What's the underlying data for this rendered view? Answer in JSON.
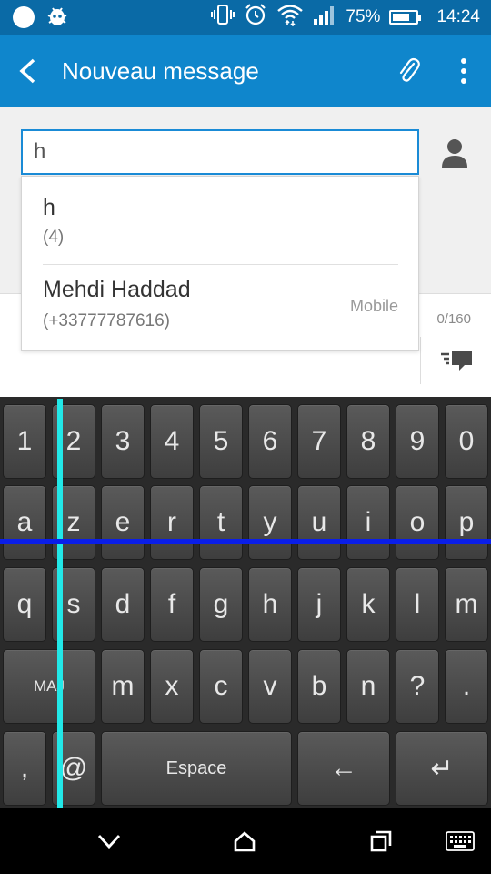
{
  "status_bar": {
    "battery_percent": "75%",
    "time": "14:24",
    "battery_level": 0.75,
    "icons": [
      "circle-notification-icon",
      "bug-icon",
      "vibrate-icon",
      "alarm-icon",
      "wifi-icon",
      "signal-icon",
      "battery-icon"
    ]
  },
  "app_bar": {
    "title": "Nouveau message",
    "icons": [
      "back-arrow-icon",
      "paperclip-icon",
      "overflow-menu-icon"
    ]
  },
  "recipient": {
    "value": "h",
    "placeholder": ""
  },
  "suggestions": [
    {
      "name": "h",
      "number": "(4)",
      "type": ""
    },
    {
      "name": "Mehdi Haddad",
      "number": "(+33777787616)",
      "type": "Mobile"
    }
  ],
  "compose": {
    "char_count": "0/160"
  },
  "keyboard": {
    "rows": [
      [
        "1",
        "2",
        "3",
        "4",
        "5",
        "6",
        "7",
        "8",
        "9",
        "0"
      ],
      [
        "a",
        "z",
        "e",
        "r",
        "t",
        "y",
        "u",
        "i",
        "o",
        "p"
      ],
      [
        "q",
        "s",
        "d",
        "f",
        "g",
        "h",
        "j",
        "k",
        "l",
        "m"
      ],
      [
        "MAJ",
        "m",
        "x",
        "c",
        "v",
        "b",
        "n",
        "?",
        "."
      ],
      [
        ",",
        "@",
        "Espace",
        "←",
        "↵"
      ]
    ]
  },
  "nav_bar": {
    "icons": [
      "back-chevron-icon",
      "home-icon",
      "recents-icon",
      "keyboard-icon"
    ]
  },
  "colors": {
    "status_bar": "#0a6aa6",
    "app_bar": "#0f86cc",
    "input_border": "#1a8bd6",
    "guide_cyan": "#22e8e8",
    "guide_blue": "#0a1ee8"
  }
}
